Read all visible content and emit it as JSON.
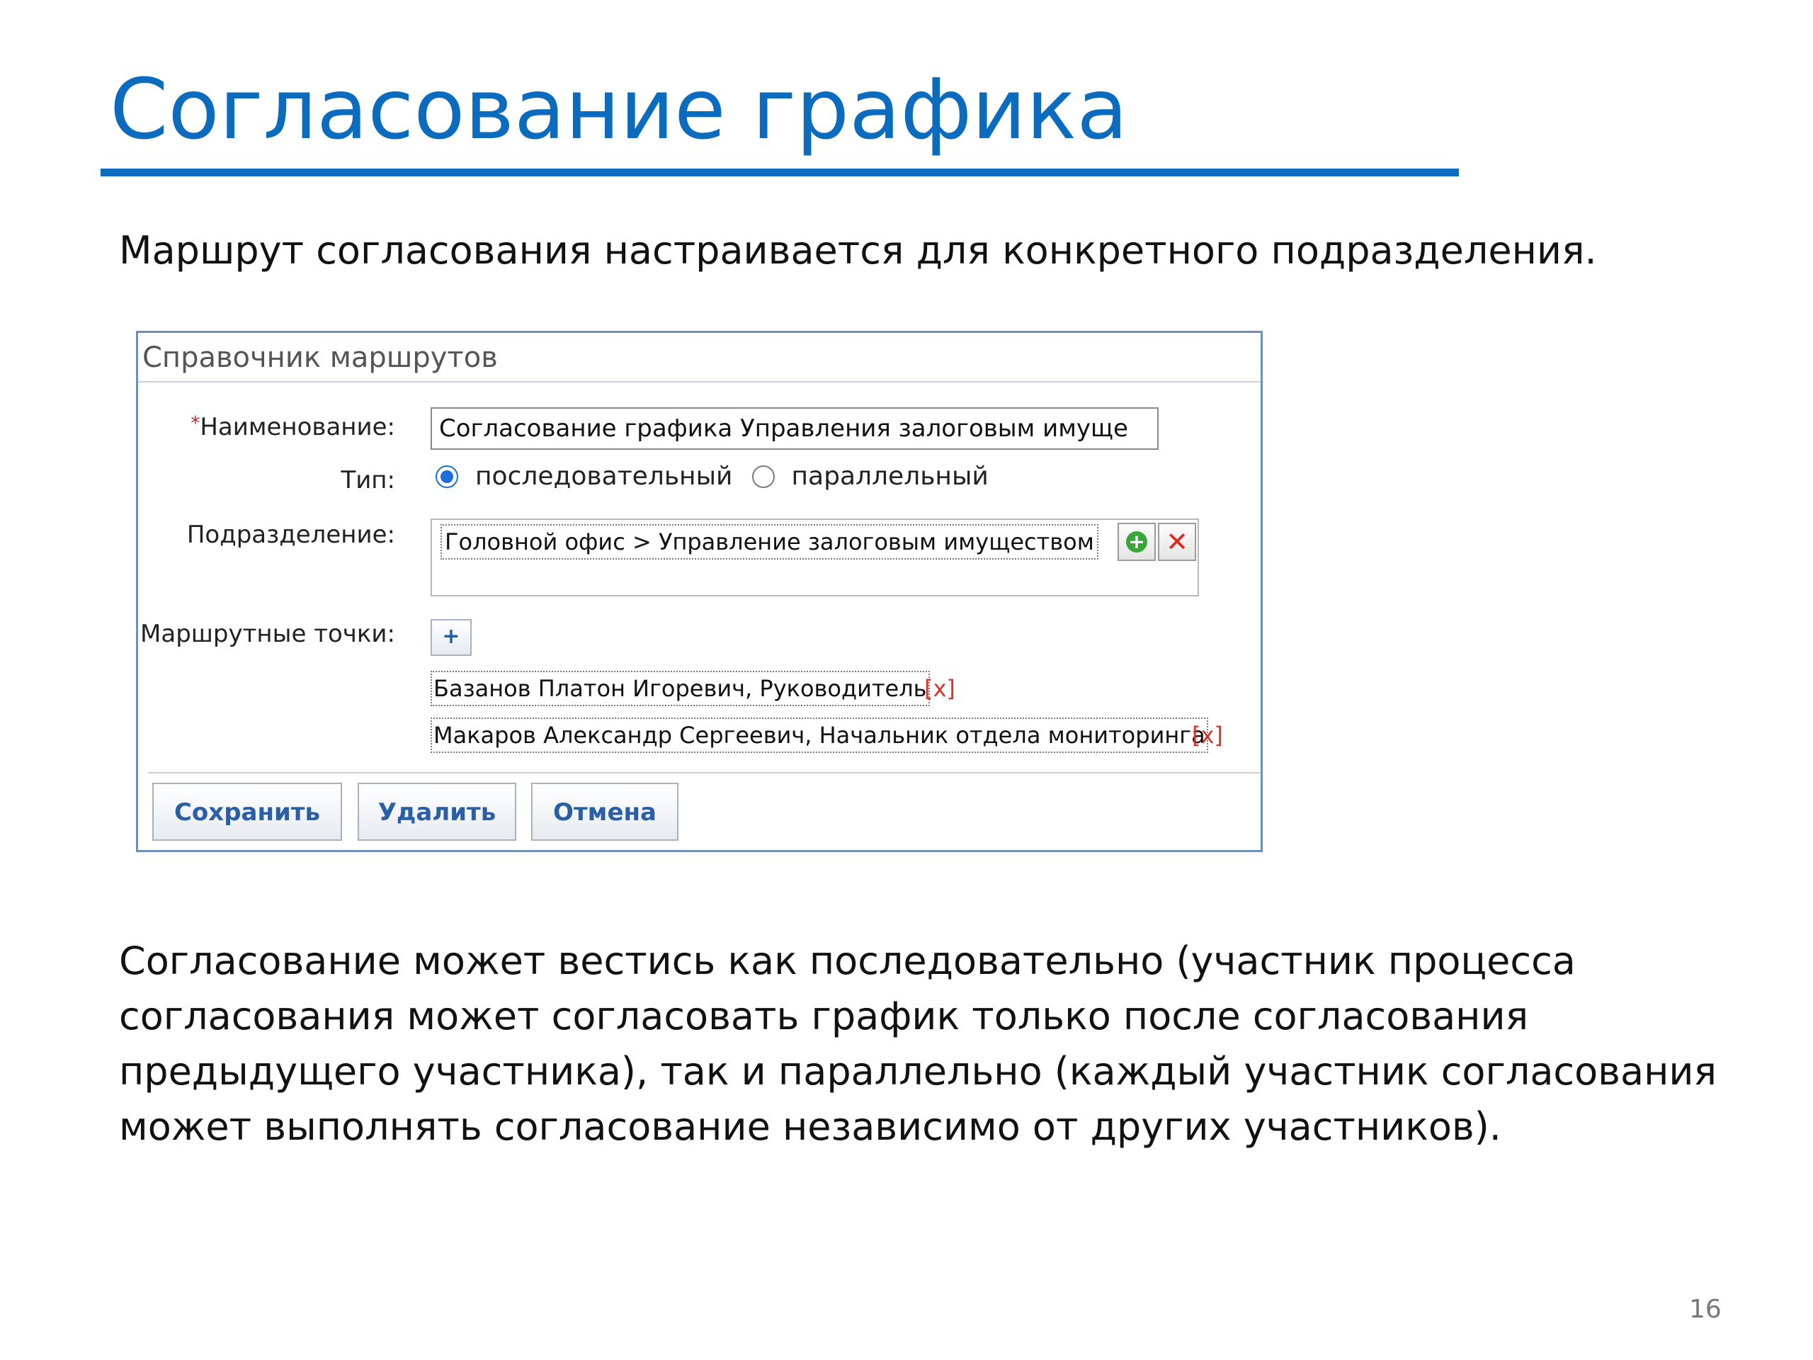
{
  "slide": {
    "title": "Согласование графика",
    "intro": "Маршрут согласования настраивается для конкретного подразделения.",
    "paragraph": "Согласование может вестись как последовательно (участник процесса согласования может согласовать график только после согласования предыдущего участника), так и параллельно (каждый участник согласования может выполнять согласование независимо от других участников).",
    "page_number": "16"
  },
  "dialog": {
    "title": "Справочник маршрутов",
    "name_label": "Наименование:",
    "required_mark": "*",
    "name_value": "Согласование графика Управления залоговым имуще",
    "type_label": "Тип:",
    "type_options": [
      {
        "label": "последовательный",
        "selected": true
      },
      {
        "label": "параллельный",
        "selected": false
      }
    ],
    "dept_label": "Подразделение:",
    "dept_value": "Головной офис > Управление залоговым имуществом",
    "points_label": "Маршрутные точки:",
    "add_point_symbol": "+",
    "points": [
      {
        "text": "Базанов Платон Игоревич, Руководитель",
        "remove": "[x]"
      },
      {
        "text": "Макаров Александр Сергеевич, Начальник отдела мониторинга",
        "remove": "[x]"
      }
    ],
    "buttons": {
      "save": "Сохранить",
      "delete": "Удалить",
      "cancel": "Отмена"
    }
  },
  "icons": {
    "dept_add": "plus-circle-green-icon",
    "dept_clear": "close-red-icon"
  },
  "colors": {
    "accent": "#0b6cbf",
    "dialog_border": "#6f8fb8",
    "button_text": "#2a5fa8",
    "remove_link": "#d8342a"
  }
}
